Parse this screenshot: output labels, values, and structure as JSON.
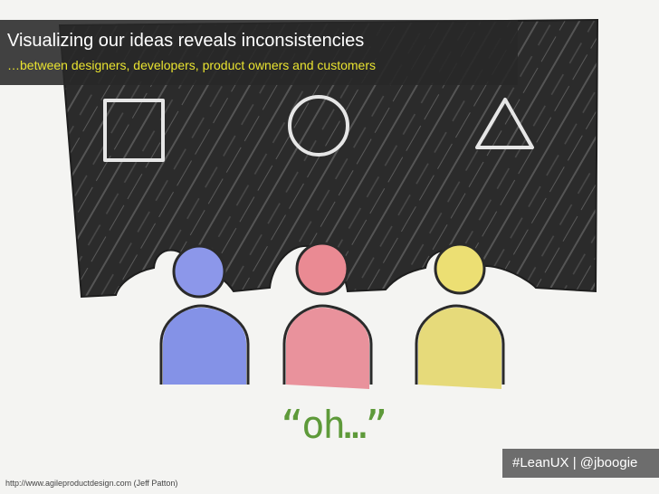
{
  "slide": {
    "title": "Visualizing our ideas reveals inconsistencies",
    "subtitle": "…between designers, developers, product owners and customers",
    "tag": "#LeanUX | @jboogie",
    "source": "http://www.agileproductdesign.com (Jeff Patton)"
  },
  "illustration": {
    "speech": "“oh…”",
    "shapes": [
      "square-icon",
      "circle-icon",
      "triangle-icon"
    ],
    "colors": {
      "board": "#2a2a2a",
      "person_blue": "#6f7fe0",
      "person_red": "#e57d87",
      "person_yellow": "#e3d66a",
      "speech_text": "#5e9a3a"
    }
  }
}
